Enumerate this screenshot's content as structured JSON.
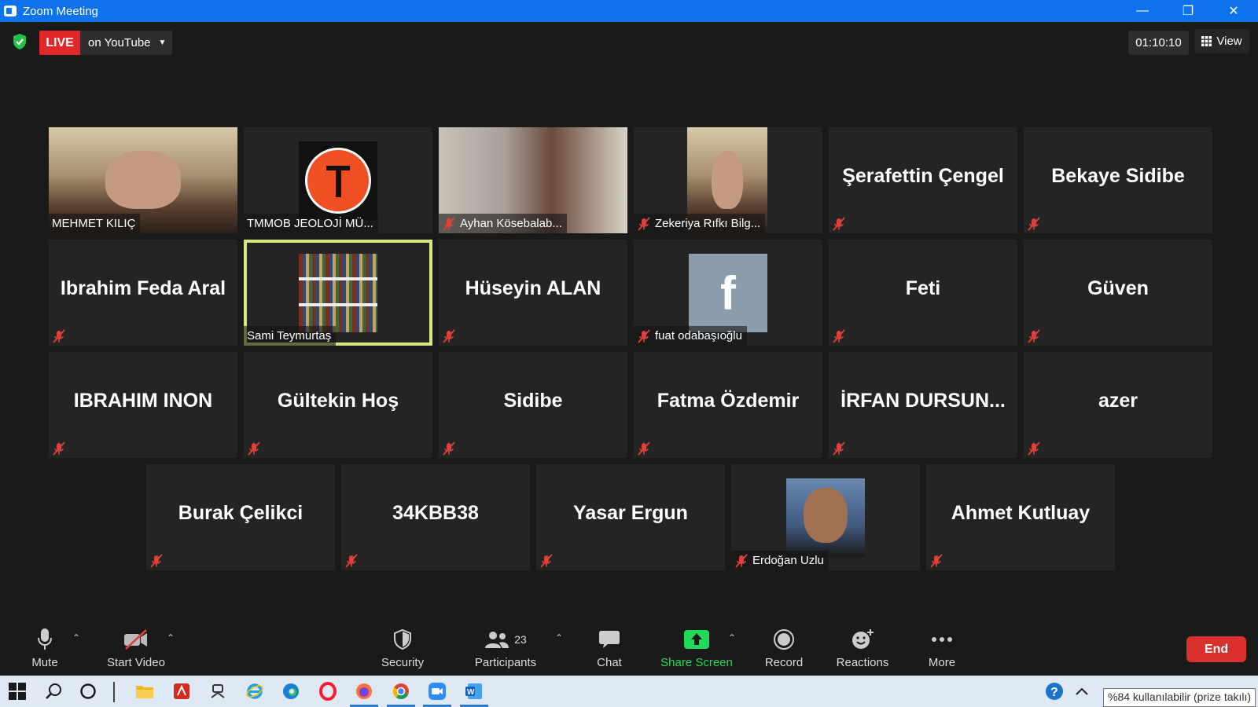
{
  "window": {
    "title": "Zoom Meeting"
  },
  "topbar": {
    "live_label": "LIVE",
    "live_destination": "on YouTube",
    "timer": "01:10:10",
    "view_label": "View"
  },
  "tiles": [
    {
      "name": "MEHMET KILIÇ",
      "muted": false,
      "video": "photo"
    },
    {
      "name": "TMMOB JEOLOJİ MÜ...",
      "muted": false,
      "video": "logo"
    },
    {
      "name": "Ayhan Kösebalab...",
      "muted": true,
      "video": "room"
    },
    {
      "name": "Zekeriya Rıfkı Bilg...",
      "muted": true,
      "video": "photo"
    },
    {
      "name": "Şerafettin Çengel",
      "muted": true,
      "video": "none"
    },
    {
      "name": "Bekaye Sidibe",
      "muted": true,
      "video": "none"
    },
    {
      "name": "Ibrahim Feda Aral",
      "muted": true,
      "video": "none"
    },
    {
      "name": "Sami Teymurtaş",
      "muted": false,
      "video": "books",
      "active": true
    },
    {
      "name": "Hüseyin ALAN",
      "muted": true,
      "video": "none"
    },
    {
      "name": "fuat odabaşıoğlu",
      "muted": true,
      "video": "facebook"
    },
    {
      "name": "Feti",
      "muted": true,
      "video": "none"
    },
    {
      "name": "Güven",
      "muted": true,
      "video": "none"
    },
    {
      "name": "IBRAHIM INON",
      "muted": true,
      "video": "none"
    },
    {
      "name": "Gültekin Hoş",
      "muted": true,
      "video": "none"
    },
    {
      "name": "Sidibe",
      "muted": true,
      "video": "none"
    },
    {
      "name": "Fatma Özdemir",
      "muted": true,
      "video": "none"
    },
    {
      "name": "İRFAN  DURSUN...",
      "muted": true,
      "video": "none"
    },
    {
      "name": "azer",
      "muted": true,
      "video": "none"
    },
    {
      "name": "Burak Çelikci",
      "muted": true,
      "video": "none"
    },
    {
      "name": "34KBB38",
      "muted": true,
      "video": "none"
    },
    {
      "name": "Yasar Ergun",
      "muted": true,
      "video": "none"
    },
    {
      "name": "Erdoğan Uzlu",
      "muted": true,
      "video": "photo2"
    },
    {
      "name": "Ahmet Kutluay",
      "muted": true,
      "video": "none"
    }
  ],
  "toolbar": {
    "mute": "Mute",
    "start_video": "Start Video",
    "security": "Security",
    "participants": "Participants",
    "participants_count": "23",
    "chat": "Chat",
    "share_screen": "Share Screen",
    "record": "Record",
    "reactions": "Reactions",
    "more": "More",
    "end": "End"
  },
  "taskbar": {
    "tooltip": "%84 kullanılabilir (prize takılı)"
  },
  "colors": {
    "titlebar": "#0e72ed",
    "live": "#e02828",
    "active_speaker": "#d4ea7c",
    "share_screen": "#23d959",
    "end": "#d9302e",
    "muted_icon": "#e0403a"
  }
}
